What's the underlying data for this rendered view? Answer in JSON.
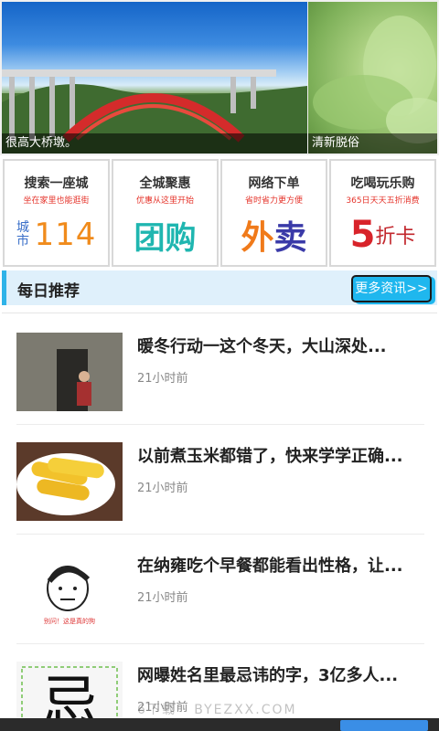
{
  "banner": {
    "main_caption": "很高大桥墩。",
    "side_caption": "清新脱俗"
  },
  "services": [
    {
      "title": "搜索一座城",
      "subtitle": "坐在家里也能逛街",
      "big_small": "城市",
      "big": "114"
    },
    {
      "title": "全城聚惠",
      "subtitle": "优惠从这里开始",
      "big": "团购"
    },
    {
      "title": "网络下单",
      "subtitle": "省时省力更方便",
      "big_a": "外",
      "big_b": "卖"
    },
    {
      "title": "吃喝玩乐购",
      "subtitle": "365日天天五折消费",
      "big": "5",
      "big_small": "折卡"
    }
  ],
  "section": {
    "title": "每日推荐",
    "more_label": "更多资讯>>"
  },
  "news": [
    {
      "title": "暖冬行动一这个冬天，大山深处...",
      "time": "21小时前"
    },
    {
      "title": "以前煮玉米都错了，快来学学正确...",
      "time": "21小时前"
    },
    {
      "title": "在纳雍吃个早餐都能看出性格，让...",
      "time": "21小时前"
    },
    {
      "title": "网曝姓名里最忌讳的字，3亿多人...",
      "time": "21小时前"
    }
  ],
  "thumb3_caption": "别问！这是真的狗",
  "thumb4_char": "忌",
  "watermark": "6下载 · BYEZXX.COM"
}
